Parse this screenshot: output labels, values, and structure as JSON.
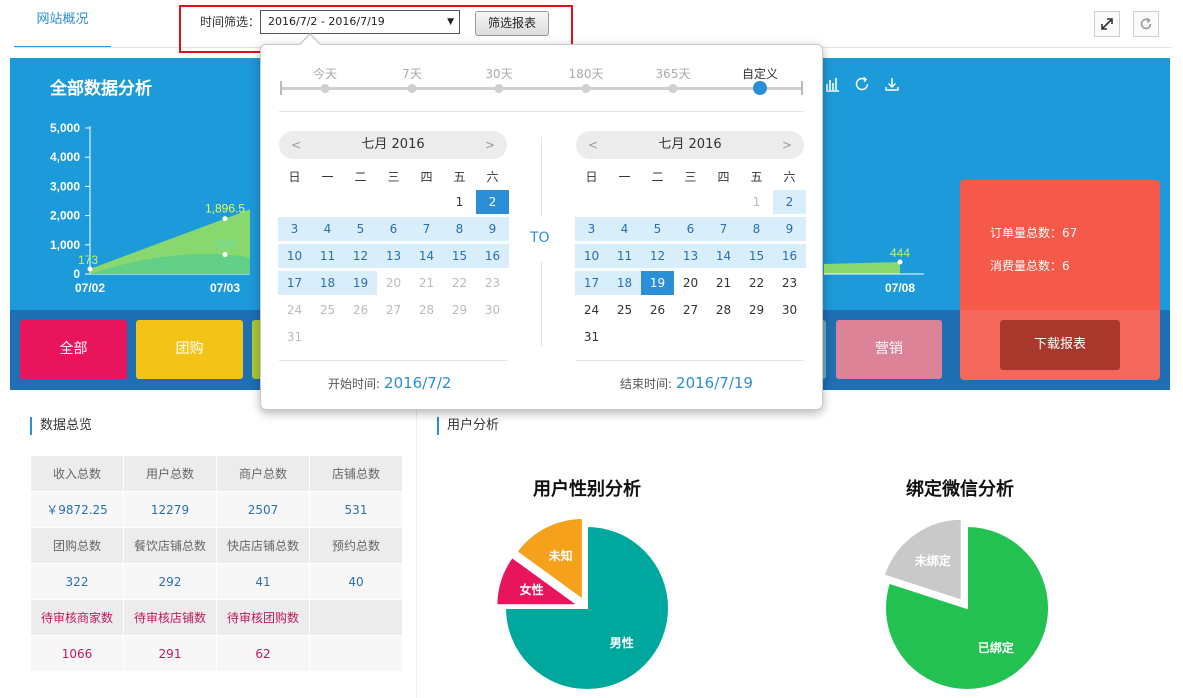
{
  "top": {
    "tab_overview": "网站概况",
    "filter_label": "时间筛选：",
    "date_range_value": "2016/7/2 - 2016/7/19",
    "filter_button": "筛选报表",
    "expand_icon": "expand-icon",
    "refresh_icon": "refresh-icon"
  },
  "panel": {
    "title": "全部数据分析",
    "icons": [
      "bar-chart-icon",
      "refresh-icon",
      "download-icon"
    ],
    "order_total_label": "订单量总数：67",
    "consume_total_label": "消费量总数：6",
    "download_button": "下载报表",
    "categories": [
      {
        "label": "全部",
        "color": "#e8155d"
      },
      {
        "label": "团购",
        "color": "#f2c417"
      },
      {
        "label": "营销",
        "color": "#dc8398"
      }
    ]
  },
  "chart_data": {
    "type": "area",
    "title": "",
    "xlabel": "",
    "ylabel": "",
    "ylim": [
      0,
      5000
    ],
    "y_ticks": [
      "0",
      "1,000",
      "2,000",
      "3,000",
      "4,000",
      "5,000"
    ],
    "x": [
      "07/02",
      "07/03",
      "07/08"
    ],
    "series": [
      {
        "values": [
          173,
          1896.5,
          444
        ],
        "color": "#9be35c"
      },
      {
        "values": [
          null,
          666,
          null
        ],
        "color": "#5fce8a"
      }
    ],
    "data_labels": [
      "173",
      "1,896.5",
      "666",
      "444"
    ],
    "grid": false
  },
  "datepicker": {
    "ranges": [
      "今天",
      "7天",
      "30天",
      "180天",
      "365天",
      "自定义"
    ],
    "active_range": "自定义",
    "to_label": "TO",
    "weekdays": [
      "日",
      "一",
      "二",
      "三",
      "四",
      "五",
      "六"
    ],
    "left": {
      "title": "七月 2016",
      "prev": "<",
      "next": ">",
      "footer_label": "开始时间:",
      "footer_value": "2016/7/2",
      "rows": [
        [
          {
            "d": ""
          },
          {
            "d": ""
          },
          {
            "d": ""
          },
          {
            "d": ""
          },
          {
            "d": ""
          },
          {
            "d": "1"
          },
          {
            "d": "2",
            "s": "sel"
          }
        ],
        [
          {
            "d": "3",
            "s": "range"
          },
          {
            "d": "4",
            "s": "range"
          },
          {
            "d": "5",
            "s": "range"
          },
          {
            "d": "6",
            "s": "range"
          },
          {
            "d": "7",
            "s": "range"
          },
          {
            "d": "8",
            "s": "range"
          },
          {
            "d": "9",
            "s": "range"
          }
        ],
        [
          {
            "d": "10",
            "s": "range"
          },
          {
            "d": "11",
            "s": "range"
          },
          {
            "d": "12",
            "s": "range"
          },
          {
            "d": "13",
            "s": "range"
          },
          {
            "d": "14",
            "s": "range"
          },
          {
            "d": "15",
            "s": "range"
          },
          {
            "d": "16",
            "s": "range"
          }
        ],
        [
          {
            "d": "17",
            "s": "range"
          },
          {
            "d": "18",
            "s": "range"
          },
          {
            "d": "19",
            "s": "range"
          },
          {
            "d": "20",
            "s": "muted"
          },
          {
            "d": "21",
            "s": "muted"
          },
          {
            "d": "22",
            "s": "muted"
          },
          {
            "d": "23",
            "s": "muted"
          }
        ],
        [
          {
            "d": "24",
            "s": "muted"
          },
          {
            "d": "25",
            "s": "muted"
          },
          {
            "d": "26",
            "s": "muted"
          },
          {
            "d": "27",
            "s": "muted"
          },
          {
            "d": "28",
            "s": "muted"
          },
          {
            "d": "29",
            "s": "muted"
          },
          {
            "d": "30",
            "s": "muted"
          }
        ],
        [
          {
            "d": "31",
            "s": "muted"
          }
        ]
      ]
    },
    "right": {
      "title": "七月 2016",
      "prev": "<",
      "next": ">",
      "footer_label": "结束时间:",
      "footer_value": "2016/7/19",
      "rows": [
        [
          {
            "d": ""
          },
          {
            "d": ""
          },
          {
            "d": ""
          },
          {
            "d": ""
          },
          {
            "d": ""
          },
          {
            "d": "1",
            "s": "muted"
          },
          {
            "d": "2",
            "s": "range"
          }
        ],
        [
          {
            "d": "3",
            "s": "range"
          },
          {
            "d": "4",
            "s": "range"
          },
          {
            "d": "5",
            "s": "range"
          },
          {
            "d": "6",
            "s": "range"
          },
          {
            "d": "7",
            "s": "range"
          },
          {
            "d": "8",
            "s": "range"
          },
          {
            "d": "9",
            "s": "range"
          }
        ],
        [
          {
            "d": "10",
            "s": "range"
          },
          {
            "d": "11",
            "s": "range"
          },
          {
            "d": "12",
            "s": "range"
          },
          {
            "d": "13",
            "s": "range"
          },
          {
            "d": "14",
            "s": "range"
          },
          {
            "d": "15",
            "s": "range"
          },
          {
            "d": "16",
            "s": "range"
          }
        ],
        [
          {
            "d": "17",
            "s": "range"
          },
          {
            "d": "18",
            "s": "range"
          },
          {
            "d": "19",
            "s": "sel"
          },
          {
            "d": "20"
          },
          {
            "d": "21"
          },
          {
            "d": "22"
          },
          {
            "d": "23"
          }
        ],
        [
          {
            "d": "24"
          },
          {
            "d": "25"
          },
          {
            "d": "26"
          },
          {
            "d": "27"
          },
          {
            "d": "28"
          },
          {
            "d": "29"
          },
          {
            "d": "30"
          }
        ],
        [
          {
            "d": "31"
          }
        ]
      ]
    }
  },
  "overview": {
    "title": "数据总览",
    "rows": [
      {
        "type": "head",
        "cells": [
          "收入总数",
          "用户总数",
          "商户总数",
          "店铺总数"
        ]
      },
      {
        "type": "vals",
        "cells": [
          "￥9872.25",
          "12279",
          "2507",
          "531"
        ]
      },
      {
        "type": "head",
        "cells": [
          "团购总数",
          "餐饮店铺总数",
          "快店店铺总数",
          "预约总数"
        ]
      },
      {
        "type": "vals",
        "cells": [
          "322",
          "292",
          "41",
          "40"
        ]
      },
      {
        "type": "head pending",
        "cells": [
          "待审核商家数",
          "待审核店铺数",
          "待审核团购数",
          ""
        ]
      },
      {
        "type": "vals pending",
        "cells": [
          "1066",
          "291",
          "62",
          ""
        ]
      }
    ]
  },
  "user_analysis": {
    "title": "用户分析",
    "gender_chart": {
      "title": "用户性别分析",
      "slices": [
        {
          "label": "男性",
          "value": 75,
          "color": "#00a79d"
        },
        {
          "label": "女性",
          "value": 10,
          "color": "#e8155d"
        },
        {
          "label": "未知",
          "value": 15,
          "color": "#f5a11c"
        }
      ]
    },
    "wechat_chart": {
      "title": "绑定微信分析",
      "slices": [
        {
          "label": "已绑定",
          "value": 80,
          "color": "#22c152"
        },
        {
          "label": "未绑定",
          "value": 20,
          "color": "#c9c9c9"
        }
      ]
    }
  }
}
